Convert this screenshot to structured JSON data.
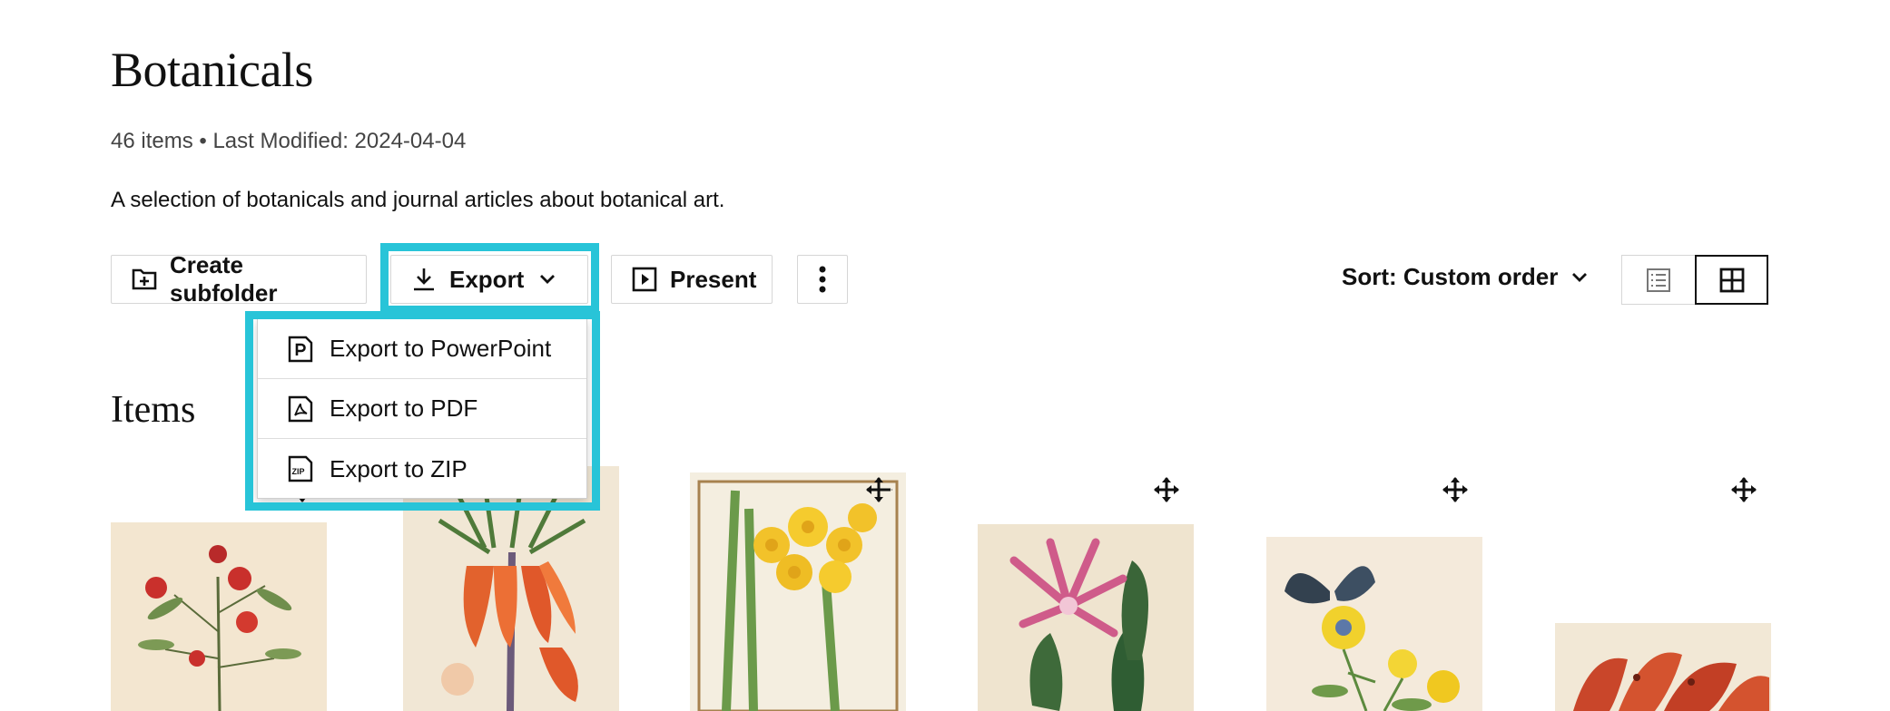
{
  "header": {
    "title": "Botanicals",
    "meta": "46 items • Last Modified: 2024-04-04",
    "description": "A selection of botanicals and journal articles about botanical art."
  },
  "toolbar": {
    "create_subfolder": "Create subfolder",
    "export": "Export",
    "present": "Present",
    "sort_label": "Sort: Custom order"
  },
  "export_menu": {
    "items": [
      {
        "label": "Export to PowerPoint",
        "icon": "powerpoint-icon"
      },
      {
        "label": "Export to PDF",
        "icon": "pdf-icon"
      },
      {
        "label": "Export to ZIP",
        "icon": "zip-icon"
      }
    ]
  },
  "section": {
    "items_heading": "Items"
  },
  "colors": {
    "highlight": "#28c4d8",
    "border": "#d6d6d6",
    "text": "#111111"
  },
  "thumbnails": [
    {
      "icon": "flowering-branch-illustration"
    },
    {
      "icon": "crown-imperial-illustration"
    },
    {
      "icon": "daffodil-illustration"
    },
    {
      "icon": "cactus-flower-illustration"
    },
    {
      "icon": "butterfly-flower-illustration"
    },
    {
      "icon": "lily-illustration"
    }
  ]
}
